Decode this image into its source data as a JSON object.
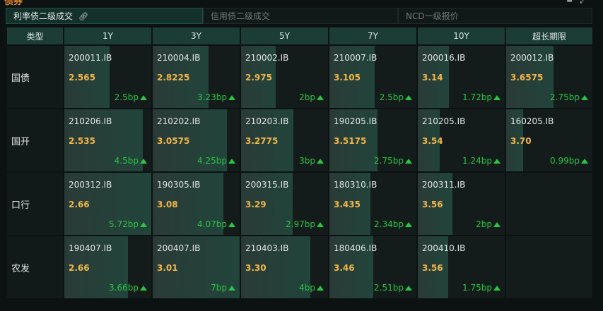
{
  "panel": {
    "title": "债券"
  },
  "tabs": [
    {
      "label": "利率债二级成交",
      "active": true
    },
    {
      "label": "信用债二级成交",
      "active": false
    },
    {
      "label": "NCD一级报价",
      "active": false
    }
  ],
  "colors": {
    "rate": "#f2b64a",
    "up": "#29c544",
    "header": "#1b3d36",
    "accent": "#e88a30"
  },
  "table": {
    "headers": [
      "类型",
      "1Y",
      "3Y",
      "5Y",
      "7Y",
      "10Y",
      "超长期限"
    ],
    "rows": [
      {
        "type": "国债",
        "cells": [
          {
            "code": "200011.IB",
            "rate": "2.565",
            "change": "2.5bp",
            "fill": 0.52
          },
          {
            "code": "210004.IB",
            "rate": "2.8225",
            "change": "3.23bp",
            "fill": 0.64
          },
          {
            "code": "210002.IB",
            "rate": "2.975",
            "change": "2bp",
            "fill": 0.4
          },
          {
            "code": "210007.IB",
            "rate": "3.105",
            "change": "2.5bp",
            "fill": 0.52
          },
          {
            "code": "200016.IB",
            "rate": "3.14",
            "change": "1.72bp",
            "fill": 0.36
          },
          {
            "code": "200012.IB",
            "rate": "3.6575",
            "change": "2.75bp",
            "fill": 0.55
          }
        ]
      },
      {
        "type": "国开",
        "cells": [
          {
            "code": "210206.IB",
            "rate": "2.535",
            "change": "4.5bp",
            "fill": 0.9
          },
          {
            "code": "210202.IB",
            "rate": "3.0575",
            "change": "4.25bp",
            "fill": 0.85
          },
          {
            "code": "210203.IB",
            "rate": "3.2775",
            "change": "3bp",
            "fill": 0.6
          },
          {
            "code": "190205.IB",
            "rate": "3.5175",
            "change": "2.75bp",
            "fill": 0.55
          },
          {
            "code": "210205.IB",
            "rate": "3.54",
            "change": "1.24bp",
            "fill": 0.25
          },
          {
            "code": "160205.IB",
            "rate": "3.70",
            "change": "0.99bp",
            "fill": 0.2
          }
        ]
      },
      {
        "type": "口行",
        "cells": [
          {
            "code": "200312.IB",
            "rate": "2.66",
            "change": "5.72bp",
            "fill": 1.0
          },
          {
            "code": "190305.IB",
            "rate": "3.08",
            "change": "4.07bp",
            "fill": 0.81
          },
          {
            "code": "200315.IB",
            "rate": "3.29",
            "change": "2.97bp",
            "fill": 0.59
          },
          {
            "code": "180310.IB",
            "rate": "3.435",
            "change": "2.34bp",
            "fill": 0.47
          },
          {
            "code": "200311.IB",
            "rate": "3.56",
            "change": "2bp",
            "fill": 0.4
          },
          null
        ]
      },
      {
        "type": "农发",
        "cells": [
          {
            "code": "190407.IB",
            "rate": "2.66",
            "change": "3.66bp",
            "fill": 0.73
          },
          {
            "code": "200407.IB",
            "rate": "3.01",
            "change": "7bp",
            "fill": 1.0
          },
          {
            "code": "210403.IB",
            "rate": "3.30",
            "change": "4bp",
            "fill": 0.8
          },
          {
            "code": "180406.IB",
            "rate": "3.46",
            "change": "2.51bp",
            "fill": 0.5
          },
          {
            "code": "200410.IB",
            "rate": "3.56",
            "change": "1.75bp",
            "fill": 0.35
          },
          null
        ]
      }
    ]
  }
}
